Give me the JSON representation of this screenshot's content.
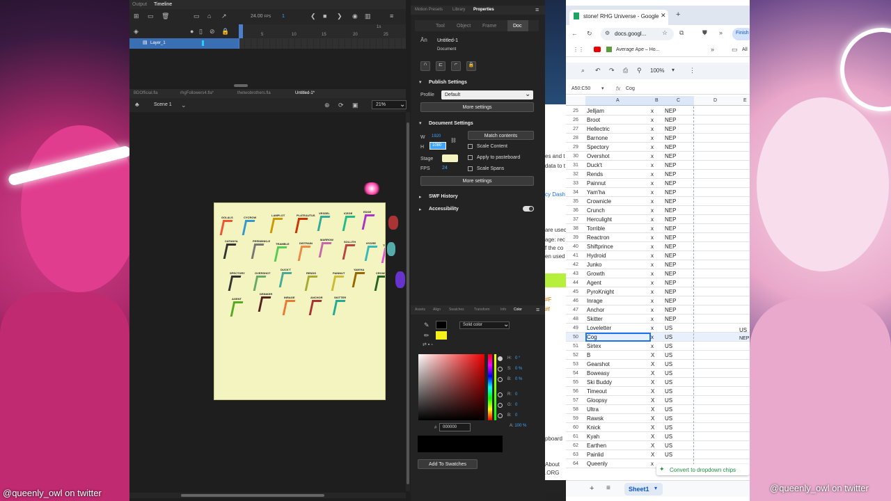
{
  "watermark": "@queenly_owl on twitter",
  "animate": {
    "tabs": [
      "Output",
      "Timeline"
    ],
    "fps": "24.00",
    "fps_unit": "FPS",
    "frame": "1",
    "layer_name": "Layer_1",
    "ruler": [
      "1s",
      "5",
      "10",
      "15",
      "20",
      "25"
    ],
    "doc_tabs": [
      "BDOfficial.fla",
      "rhgFollowers4.fla*",
      "thetwobrothers.fla",
      "Untitled-1*"
    ],
    "scene": "Scene 1",
    "zoom": "21%",
    "stage_labels": [
      "GOLALS",
      "CYCROW",
      "LAMPLOT",
      "PLATEAUTUS",
      "VESSEL",
      "ICEGE",
      "EDGE",
      "CATANYA",
      "PERIWINKLE",
      "TRAMBLE",
      "DISTRAIN",
      "MARROW",
      "SOLLITH",
      "HYDRE",
      "TICK",
      "SPECTORY",
      "OVERSHOT",
      "DUCK'T",
      "RENDS",
      "PAINNUT",
      "YAM'HA",
      "CROWNICLE",
      "AGENT",
      "DRINKER",
      "INRAGE",
      "ANCHOR",
      "SKITTER"
    ]
  },
  "props": {
    "top_tabs": [
      "Motion Presets",
      "Library",
      "Properties"
    ],
    "sub_tabs": [
      "Tool",
      "Object",
      "Frame",
      "Doc"
    ],
    "doc_name": "Untitled-1",
    "doc_type": "Document",
    "publish_settings": "Publish Settings",
    "profile_label": "Profile",
    "profile_value": "Default",
    "more_settings": "More settings",
    "document_settings": "Document Settings",
    "w_label": "W",
    "w_value": "1920",
    "h_label": "H",
    "h_value": "1080",
    "match_contents": "Match contents",
    "scale_content": "Scale Content",
    "stage_label": "Stage",
    "apply_pasteboard": "Apply to pasteboard",
    "fps_label": "FPS",
    "fps_value": "24",
    "scale_spans": "Scale Spans",
    "swf_history": "SWF History",
    "accessibility": "Accessibility",
    "color_tabs": [
      "Assets",
      "Align",
      "Swatches",
      "Transform",
      "Info",
      "Color"
    ],
    "fill_type": "Solid color",
    "hsb": [
      [
        "H:",
        "0 °"
      ],
      [
        "S:",
        "0 %"
      ],
      [
        "B:",
        "0 %"
      ]
    ],
    "rgb": [
      [
        "R:",
        "0"
      ],
      [
        "G:",
        "0"
      ],
      [
        "B:",
        "0"
      ]
    ],
    "alpha": [
      "A:",
      "100 %"
    ],
    "hex": "000000",
    "add_swatches": "Add To Swatches",
    "colors": {
      "stage": "#f3f4bf",
      "fill": "#f5f01a",
      "accent": "#3ea6ff"
    }
  },
  "chrome": {
    "tab_title": "stone! RHG Universe - Google",
    "url": "docs.googl...",
    "finish": "Finish",
    "bookmark": "Average Ape – Ho...",
    "bookmark2": "All",
    "zoom": "100%",
    "cell_ref": "A50:C50",
    "formula": "Cog",
    "columns": [
      "A",
      "B",
      "C",
      "D",
      "E"
    ],
    "side_e_values": [
      "US",
      "NEP"
    ],
    "rows": [
      [
        "25",
        "Jelljam",
        "x",
        "NEP"
      ],
      [
        "26",
        "Broot",
        "x",
        "NEP"
      ],
      [
        "27",
        "Hellectric",
        "x",
        "NEP"
      ],
      [
        "28",
        "Barnone",
        "x",
        "NEP"
      ],
      [
        "29",
        "Spectory",
        "x",
        "NEP"
      ],
      [
        "30",
        "Overshot",
        "x",
        "NEP"
      ],
      [
        "31",
        "Duck't",
        "x",
        "NEP"
      ],
      [
        "32",
        "Rends",
        "x",
        "NEP"
      ],
      [
        "33",
        "Painnut",
        "x",
        "NEP"
      ],
      [
        "34",
        "Yam'ha",
        "x",
        "NEP"
      ],
      [
        "35",
        "Crownicle",
        "x",
        "NEP"
      ],
      [
        "36",
        "Crunch",
        "x",
        "NEP"
      ],
      [
        "37",
        "Herculight",
        "x",
        "NEP"
      ],
      [
        "38",
        "Torrible",
        "x",
        "NEP"
      ],
      [
        "39",
        "Reactron",
        "x",
        "NEP"
      ],
      [
        "40",
        "Shiftprince",
        "x",
        "NEP"
      ],
      [
        "41",
        "Hydroid",
        "x",
        "NEP"
      ],
      [
        "42",
        "Junko",
        "x",
        "NEP"
      ],
      [
        "43",
        "Growth",
        "x",
        "NEP"
      ],
      [
        "44",
        "Agent",
        "x",
        "NEP"
      ],
      [
        "45",
        "PyroKnight",
        "x",
        "NEP"
      ],
      [
        "46",
        "Inrage",
        "x",
        "NEP"
      ],
      [
        "47",
        "Anchor",
        "x",
        "NEP"
      ],
      [
        "48",
        "Skitter",
        "x",
        "NEP"
      ],
      [
        "49",
        "Loveletter",
        "x",
        "US"
      ],
      [
        "50",
        "Cog",
        "x",
        "US"
      ],
      [
        "51",
        "Sirtex",
        "x",
        "US"
      ],
      [
        "52",
        "B",
        "X",
        "US"
      ],
      [
        "53",
        "Gearshot",
        "X",
        "US"
      ],
      [
        "54",
        "Boweasy",
        "X",
        "US"
      ],
      [
        "55",
        "Ski Buddy",
        "X",
        "US"
      ],
      [
        "56",
        "Timeout",
        "X",
        "US"
      ],
      [
        "57",
        "Gloopsy",
        "X",
        "US"
      ],
      [
        "58",
        "Ultra",
        "X",
        "US"
      ],
      [
        "59",
        "Rawsk",
        "X",
        "US"
      ],
      [
        "60",
        "Knick",
        "X",
        "US"
      ],
      [
        "61",
        "Kyah",
        "X",
        "US"
      ],
      [
        "62",
        "Earthen",
        "X",
        "US"
      ],
      [
        "63",
        "Painlid",
        "X",
        "US"
      ],
      [
        "64",
        "Queenly",
        "x",
        ""
      ]
    ],
    "chip_hint": "Convert to dropdown chips",
    "sheet_tab": "Sheet1",
    "side_snippets": [
      "es and t",
      "data to t",
      "cy Dash",
      "are usec",
      "age: rec",
      "f the co",
      "en used",
      "#F",
      "#f",
      "pboard",
      "About",
      ".ORG"
    ]
  }
}
